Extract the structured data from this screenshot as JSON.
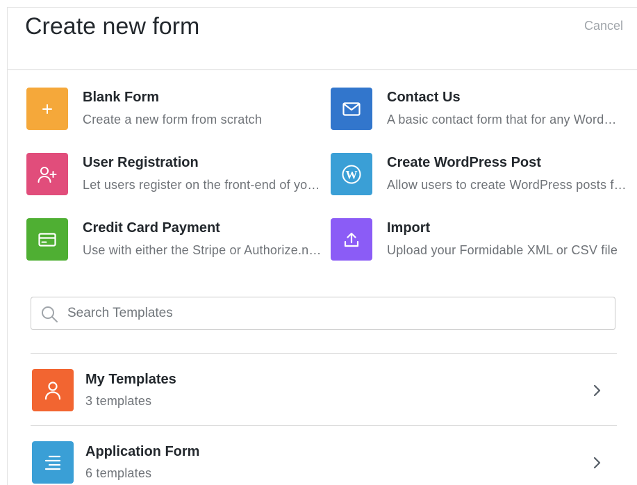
{
  "header": {
    "title": "Create new form",
    "cancel_label": "Cancel"
  },
  "options": [
    {
      "title": "Blank Form",
      "desc": "Create a new form from scratch",
      "icon": "plus-icon",
      "color": "#f5a83a"
    },
    {
      "title": "Contact Us",
      "desc": "A basic contact form that for any WordPress website.",
      "icon": "envelope-icon",
      "color": "#3276cc"
    },
    {
      "title": "User Registration",
      "desc": "Let users register on the front-end of your site",
      "icon": "user-plus-icon",
      "color": "#e14d7b"
    },
    {
      "title": "Create WordPress Post",
      "desc": "Allow users to create WordPress posts from the front-end",
      "icon": "wordpress-icon",
      "color": "#3a9fd6"
    },
    {
      "title": "Credit Card Payment",
      "desc": "Use with either the Stripe or Authorize.net add-on",
      "icon": "credit-card-icon",
      "color": "#4faf33"
    },
    {
      "title": "Import",
      "desc": "Upload your Formidable XML or CSV file",
      "icon": "upload-icon",
      "color": "#8b5cf6"
    }
  ],
  "search": {
    "placeholder": "Search Templates"
  },
  "categories": [
    {
      "title": "My Templates",
      "count": "3 templates",
      "icon": "user-icon",
      "color": "#f26531"
    },
    {
      "title": "Application Form",
      "count": "6 templates",
      "icon": "list-icon",
      "color": "#3a9fd6"
    }
  ]
}
